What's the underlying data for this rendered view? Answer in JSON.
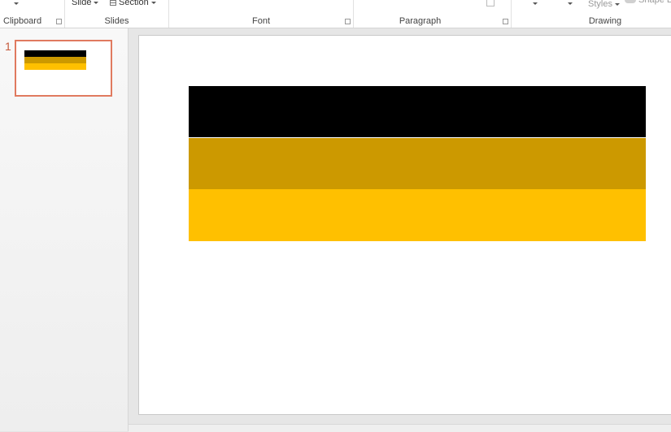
{
  "ribbon": {
    "groups": {
      "clipboard": "Clipboard",
      "slides": "Slides",
      "font": "Font",
      "paragraph": "Paragraph",
      "drawing": "Drawing"
    },
    "commands": {
      "slide": "Slide",
      "section": "Section",
      "styles": "Styles",
      "shape": "Shape E"
    }
  },
  "thumbnails": {
    "slide_number": "1"
  },
  "slide": {
    "bands": [
      {
        "name": "black",
        "color": "#000000"
      },
      {
        "name": "dark-gold",
        "color": "#cc9900"
      },
      {
        "name": "gold",
        "color": "#ffc000"
      }
    ]
  }
}
